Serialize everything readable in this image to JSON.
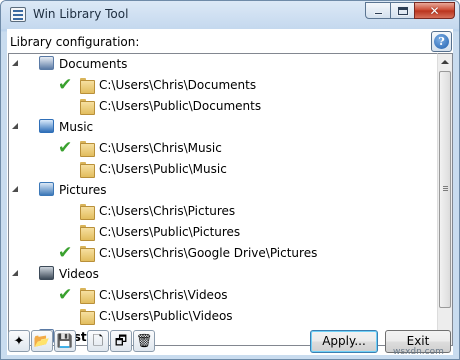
{
  "window": {
    "title": "Win Library Tool",
    "icon": "library-tool-icon"
  },
  "caption_buttons": {
    "close_glyph": "✕"
  },
  "label": "Library configuration:",
  "help_glyph": "?",
  "libraries": [
    {
      "name": "Documents",
      "icon": "documents-library-icon",
      "folders": [
        {
          "path": "C:\\Users\\Chris\\Documents",
          "checked": true
        },
        {
          "path": "C:\\Users\\Public\\Documents",
          "checked": false
        }
      ]
    },
    {
      "name": "Music",
      "icon": "music-library-icon",
      "folders": [
        {
          "path": "C:\\Users\\Chris\\Music",
          "checked": true
        },
        {
          "path": "C:\\Users\\Public\\Music",
          "checked": false
        }
      ]
    },
    {
      "name": "Pictures",
      "icon": "pictures-library-icon",
      "folders": [
        {
          "path": "C:\\Users\\Chris\\Pictures",
          "checked": false
        },
        {
          "path": "C:\\Users\\Public\\Pictures",
          "checked": false
        },
        {
          "path": "C:\\Users\\Chris\\Google Drive\\Pictures",
          "checked": true
        }
      ]
    },
    {
      "name": "Videos",
      "icon": "videos-library-icon",
      "folders": [
        {
          "path": "C:\\Users\\Chris\\Videos",
          "checked": true
        },
        {
          "path": "C:\\Users\\Public\\Videos",
          "checked": false
        }
      ]
    },
    {
      "name": "Test",
      "icon": "test-library-icon",
      "folders": []
    }
  ],
  "check_glyph": "✔",
  "toolbar": {
    "icons": [
      "new-library-icon",
      "open-icon",
      "save-icon",
      "add-folder-icon",
      "properties-icon",
      "delete-icon"
    ],
    "glyphs": [
      "✦",
      "📂",
      "💾",
      "🗋",
      "🗗",
      "🗑"
    ]
  },
  "buttons": {
    "apply": "Apply...",
    "exit": "Exit"
  },
  "watermark": "wsxdn.com",
  "colors": {
    "check": "#3aa12f",
    "close_button": "#c9452e",
    "focus_border": "#3c7fb1"
  }
}
